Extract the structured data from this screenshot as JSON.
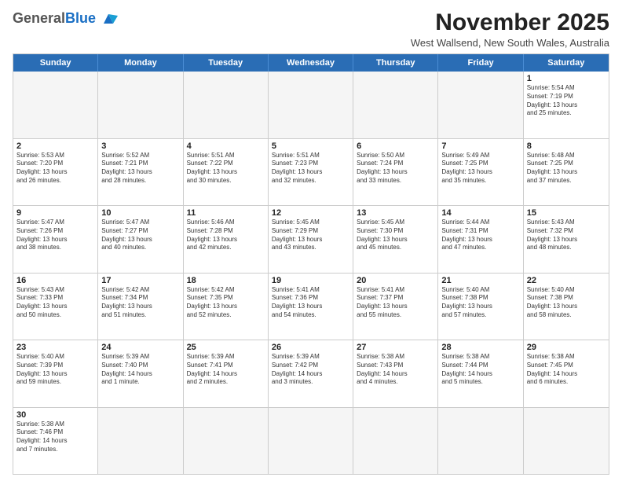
{
  "header": {
    "logo_general": "General",
    "logo_blue": "Blue",
    "month_title": "November 2025",
    "location": "West Wallsend, New South Wales, Australia"
  },
  "weekdays": [
    "Sunday",
    "Monday",
    "Tuesday",
    "Wednesday",
    "Thursday",
    "Friday",
    "Saturday"
  ],
  "weeks": [
    [
      {
        "day": "",
        "info": "",
        "empty": true
      },
      {
        "day": "",
        "info": "",
        "empty": true
      },
      {
        "day": "",
        "info": "",
        "empty": true
      },
      {
        "day": "",
        "info": "",
        "empty": true
      },
      {
        "day": "",
        "info": "",
        "empty": true
      },
      {
        "day": "",
        "info": "",
        "empty": true
      },
      {
        "day": "1",
        "info": "Sunrise: 5:54 AM\nSunset: 7:19 PM\nDaylight: 13 hours\nand 25 minutes.",
        "empty": false
      }
    ],
    [
      {
        "day": "2",
        "info": "Sunrise: 5:53 AM\nSunset: 7:20 PM\nDaylight: 13 hours\nand 26 minutes.",
        "empty": false
      },
      {
        "day": "3",
        "info": "Sunrise: 5:52 AM\nSunset: 7:21 PM\nDaylight: 13 hours\nand 28 minutes.",
        "empty": false
      },
      {
        "day": "4",
        "info": "Sunrise: 5:51 AM\nSunset: 7:22 PM\nDaylight: 13 hours\nand 30 minutes.",
        "empty": false
      },
      {
        "day": "5",
        "info": "Sunrise: 5:51 AM\nSunset: 7:23 PM\nDaylight: 13 hours\nand 32 minutes.",
        "empty": false
      },
      {
        "day": "6",
        "info": "Sunrise: 5:50 AM\nSunset: 7:24 PM\nDaylight: 13 hours\nand 33 minutes.",
        "empty": false
      },
      {
        "day": "7",
        "info": "Sunrise: 5:49 AM\nSunset: 7:25 PM\nDaylight: 13 hours\nand 35 minutes.",
        "empty": false
      },
      {
        "day": "8",
        "info": "Sunrise: 5:48 AM\nSunset: 7:25 PM\nDaylight: 13 hours\nand 37 minutes.",
        "empty": false
      }
    ],
    [
      {
        "day": "9",
        "info": "Sunrise: 5:47 AM\nSunset: 7:26 PM\nDaylight: 13 hours\nand 38 minutes.",
        "empty": false
      },
      {
        "day": "10",
        "info": "Sunrise: 5:47 AM\nSunset: 7:27 PM\nDaylight: 13 hours\nand 40 minutes.",
        "empty": false
      },
      {
        "day": "11",
        "info": "Sunrise: 5:46 AM\nSunset: 7:28 PM\nDaylight: 13 hours\nand 42 minutes.",
        "empty": false
      },
      {
        "day": "12",
        "info": "Sunrise: 5:45 AM\nSunset: 7:29 PM\nDaylight: 13 hours\nand 43 minutes.",
        "empty": false
      },
      {
        "day": "13",
        "info": "Sunrise: 5:45 AM\nSunset: 7:30 PM\nDaylight: 13 hours\nand 45 minutes.",
        "empty": false
      },
      {
        "day": "14",
        "info": "Sunrise: 5:44 AM\nSunset: 7:31 PM\nDaylight: 13 hours\nand 47 minutes.",
        "empty": false
      },
      {
        "day": "15",
        "info": "Sunrise: 5:43 AM\nSunset: 7:32 PM\nDaylight: 13 hours\nand 48 minutes.",
        "empty": false
      }
    ],
    [
      {
        "day": "16",
        "info": "Sunrise: 5:43 AM\nSunset: 7:33 PM\nDaylight: 13 hours\nand 50 minutes.",
        "empty": false
      },
      {
        "day": "17",
        "info": "Sunrise: 5:42 AM\nSunset: 7:34 PM\nDaylight: 13 hours\nand 51 minutes.",
        "empty": false
      },
      {
        "day": "18",
        "info": "Sunrise: 5:42 AM\nSunset: 7:35 PM\nDaylight: 13 hours\nand 52 minutes.",
        "empty": false
      },
      {
        "day": "19",
        "info": "Sunrise: 5:41 AM\nSunset: 7:36 PM\nDaylight: 13 hours\nand 54 minutes.",
        "empty": false
      },
      {
        "day": "20",
        "info": "Sunrise: 5:41 AM\nSunset: 7:37 PM\nDaylight: 13 hours\nand 55 minutes.",
        "empty": false
      },
      {
        "day": "21",
        "info": "Sunrise: 5:40 AM\nSunset: 7:38 PM\nDaylight: 13 hours\nand 57 minutes.",
        "empty": false
      },
      {
        "day": "22",
        "info": "Sunrise: 5:40 AM\nSunset: 7:38 PM\nDaylight: 13 hours\nand 58 minutes.",
        "empty": false
      }
    ],
    [
      {
        "day": "23",
        "info": "Sunrise: 5:40 AM\nSunset: 7:39 PM\nDaylight: 13 hours\nand 59 minutes.",
        "empty": false
      },
      {
        "day": "24",
        "info": "Sunrise: 5:39 AM\nSunset: 7:40 PM\nDaylight: 14 hours\nand 1 minute.",
        "empty": false
      },
      {
        "day": "25",
        "info": "Sunrise: 5:39 AM\nSunset: 7:41 PM\nDaylight: 14 hours\nand 2 minutes.",
        "empty": false
      },
      {
        "day": "26",
        "info": "Sunrise: 5:39 AM\nSunset: 7:42 PM\nDaylight: 14 hours\nand 3 minutes.",
        "empty": false
      },
      {
        "day": "27",
        "info": "Sunrise: 5:38 AM\nSunset: 7:43 PM\nDaylight: 14 hours\nand 4 minutes.",
        "empty": false
      },
      {
        "day": "28",
        "info": "Sunrise: 5:38 AM\nSunset: 7:44 PM\nDaylight: 14 hours\nand 5 minutes.",
        "empty": false
      },
      {
        "day": "29",
        "info": "Sunrise: 5:38 AM\nSunset: 7:45 PM\nDaylight: 14 hours\nand 6 minutes.",
        "empty": false
      }
    ],
    [
      {
        "day": "30",
        "info": "Sunrise: 5:38 AM\nSunset: 7:46 PM\nDaylight: 14 hours\nand 7 minutes.",
        "empty": false
      },
      {
        "day": "",
        "info": "",
        "empty": true
      },
      {
        "day": "",
        "info": "",
        "empty": true
      },
      {
        "day": "",
        "info": "",
        "empty": true
      },
      {
        "day": "",
        "info": "",
        "empty": true
      },
      {
        "day": "",
        "info": "",
        "empty": true
      },
      {
        "day": "",
        "info": "",
        "empty": true
      }
    ]
  ]
}
